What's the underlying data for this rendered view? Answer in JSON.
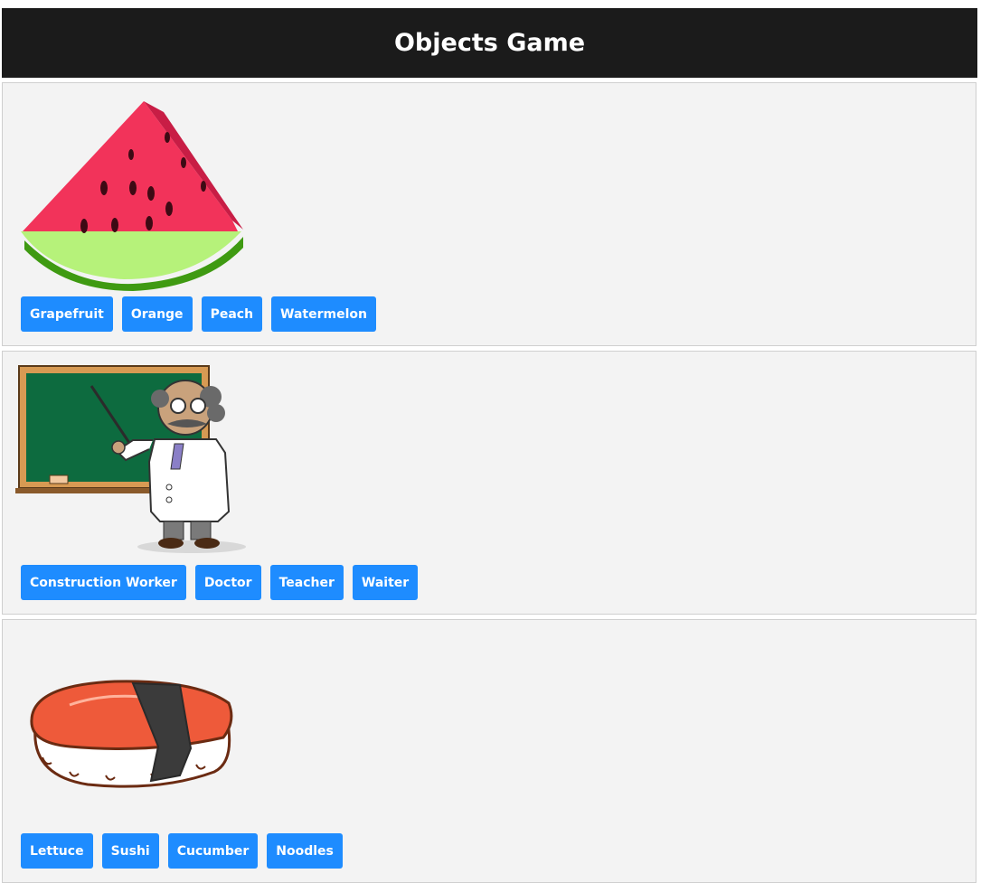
{
  "header": {
    "title": "Objects Game"
  },
  "questions": [
    {
      "picture": "watermelon-slice-picture",
      "options": [
        "Grapefruit",
        "Orange",
        "Peach",
        "Watermelon"
      ]
    },
    {
      "picture": "teacher-picture",
      "options": [
        "Construction Worker",
        "Doctor",
        "Teacher",
        "Waiter"
      ]
    },
    {
      "picture": "sushi-picture",
      "options": [
        "Lettuce",
        "Sushi",
        "Cucumber",
        "Noodles"
      ]
    }
  ],
  "colors": {
    "header_bg": "#1b1b1b",
    "card_bg": "#f3f3f3",
    "button_bg": "#1e8cff",
    "button_text": "#ffffff"
  }
}
